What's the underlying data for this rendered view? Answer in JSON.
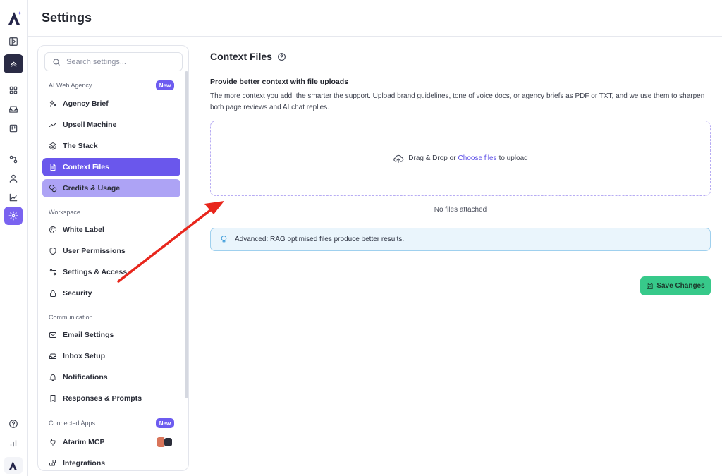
{
  "header": {
    "title": "Settings"
  },
  "rail": {
    "icons": [
      "atarim-logo-icon",
      "sidebar-toggle-icon",
      "chevron-up-icon",
      "grid-icon",
      "inbox-icon",
      "board-icon",
      "integrations-icon",
      "user-icon",
      "analytics-icon",
      "settings-gear-icon",
      "help-icon",
      "bar-chart-icon",
      "atarim-logo-small-icon"
    ]
  },
  "search": {
    "placeholder": "Search settings..."
  },
  "nav": {
    "sections": {
      "agency": "AI Web Agency",
      "workspace": "Workspace",
      "communication": "Communication",
      "connected": "Connected Apps"
    },
    "new_badge": "New",
    "items": {
      "agency_brief": "Agency Brief",
      "upsell": "Upsell Machine",
      "stack": "The Stack",
      "context_files": "Context Files",
      "credits": "Credits & Usage",
      "white_label": "White Label",
      "user_permissions": "User Permissions",
      "settings_access": "Settings & Access",
      "security": "Security",
      "email_settings": "Email Settings",
      "inbox_setup": "Inbox Setup",
      "notifications": "Notifications",
      "responses": "Responses & Prompts",
      "atarim_mcp": "Atarim MCP",
      "integrations": "Integrations"
    }
  },
  "main": {
    "title": "Context Files",
    "subheading": "Provide better context with file uploads",
    "description": "The more context you add, the smarter the support. Upload brand guidelines, tone of voice docs, or agency briefs as PDF or TXT, and we use them to sharpen both page reviews and AI chat replies.",
    "drop": {
      "before": "Drag & Drop or",
      "link": "Choose files",
      "after": "to upload"
    },
    "no_files": "No files attached",
    "tip": "Advanced: RAG optimised files produce better results.",
    "save": "Save Changes"
  },
  "colors": {
    "accent": "#6a57ec",
    "accent_light": "#ada3f5",
    "save_green": "#37c98a",
    "tip_bg": "#eaf5fc",
    "annotation_arrow": "#e8261c"
  }
}
